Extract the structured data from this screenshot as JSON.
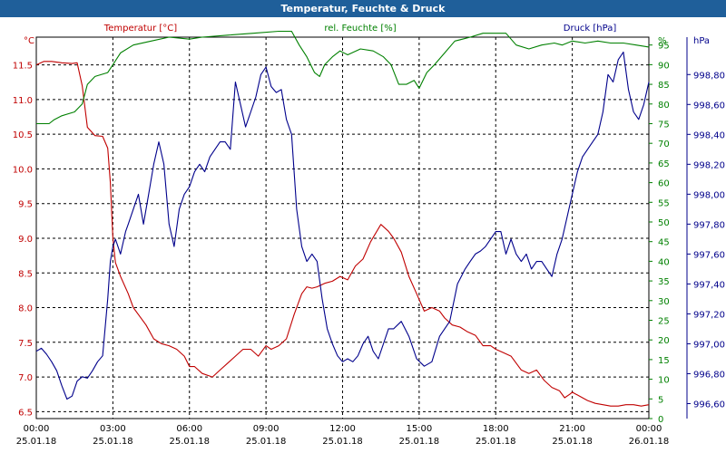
{
  "window": {
    "title": "Temperatur, Feuchte & Druck"
  },
  "axes": {
    "left": {
      "unit": "°C",
      "header": "Temperatur [°C]",
      "color": "#c00000",
      "range": [
        6.4,
        11.9
      ],
      "ticks": [
        "6.5",
        "7.0",
        "7.5",
        "8.0",
        "8.5",
        "9.0",
        "9.5",
        "10.0",
        "10.5",
        "11.0",
        "11.5"
      ]
    },
    "mid": {
      "unit": "%",
      "header": "rel. Feuchte [%]",
      "color": "#008000",
      "range": [
        0,
        97
      ],
      "ticks": [
        "0",
        "5",
        "10",
        "15",
        "20",
        "25",
        "30",
        "35",
        "40",
        "45",
        "50",
        "55",
        "60",
        "65",
        "70",
        "75",
        "80",
        "85",
        "90",
        "95"
      ]
    },
    "right": {
      "unit": "hPa",
      "header": "Druck [hPa]",
      "color": "#00008b",
      "range": [
        996.5,
        999.05
      ],
      "ticks": [
        "996,60",
        "996,80",
        "997,00",
        "997,20",
        "997,40",
        "997,60",
        "997,80",
        "998,00",
        "998,20",
        "998,40",
        "998,60",
        "998,80"
      ]
    }
  },
  "x_ticks": [
    {
      "time": "00:00",
      "date": "25.01.18"
    },
    {
      "time": "03:00",
      "date": "25.01.18"
    },
    {
      "time": "06:00",
      "date": "25.01.18"
    },
    {
      "time": "09:00",
      "date": "25.01.18"
    },
    {
      "time": "12:00",
      "date": "25.01.18"
    },
    {
      "time": "15:00",
      "date": "25.01.18"
    },
    {
      "time": "18:00",
      "date": "25.01.18"
    },
    {
      "time": "21:00",
      "date": "25.01.18"
    },
    {
      "time": "00:00",
      "date": "26.01.18"
    }
  ],
  "chart_data": {
    "type": "line",
    "x_range": [
      0,
      24
    ],
    "x_unit": "hours",
    "grid": true,
    "series": [
      {
        "name": "Temperatur [°C]",
        "axis": "left",
        "color": "#c00000",
        "x": [
          0,
          0.3,
          0.6,
          1.0,
          1.4,
          1.6,
          1.8,
          2.0,
          2.3,
          2.6,
          2.8,
          2.9,
          3.0,
          3.1,
          3.3,
          3.6,
          3.8,
          4.0,
          4.3,
          4.6,
          4.9,
          5.2,
          5.5,
          5.8,
          6.0,
          6.2,
          6.5,
          6.9,
          7.2,
          7.5,
          7.8,
          8.1,
          8.4,
          8.7,
          9.0,
          9.2,
          9.5,
          9.8,
          10.1,
          10.4,
          10.6,
          10.8,
          11.0,
          11.3,
          11.6,
          11.9,
          12.2,
          12.5,
          12.8,
          13.1,
          13.5,
          13.8,
          14.0,
          14.3,
          14.6,
          14.9,
          15.2,
          15.5,
          15.8,
          16.0,
          16.3,
          16.6,
          16.9,
          17.2,
          17.5,
          17.8,
          18.0,
          18.3,
          18.6,
          19.0,
          19.3,
          19.6,
          19.9,
          20.2,
          20.5,
          20.7,
          20.9,
          21.0,
          21.3,
          21.6,
          21.9,
          22.2,
          22.5,
          22.8,
          23.1,
          23.4,
          23.7,
          24.0
        ],
        "values": [
          11.5,
          11.55,
          11.55,
          11.53,
          11.52,
          11.53,
          11.2,
          10.6,
          10.48,
          10.47,
          10.3,
          9.8,
          9.0,
          8.65,
          8.45,
          8.2,
          8.0,
          7.9,
          7.75,
          7.55,
          7.48,
          7.45,
          7.4,
          7.3,
          7.15,
          7.15,
          7.05,
          7.0,
          7.1,
          7.2,
          7.3,
          7.4,
          7.4,
          7.3,
          7.45,
          7.4,
          7.45,
          7.55,
          7.9,
          8.2,
          8.3,
          8.28,
          8.3,
          8.35,
          8.38,
          8.45,
          8.4,
          8.6,
          8.7,
          8.95,
          9.2,
          9.1,
          9.0,
          8.8,
          8.45,
          8.2,
          7.95,
          8.0,
          7.95,
          7.85,
          7.75,
          7.72,
          7.65,
          7.6,
          7.45,
          7.45,
          7.4,
          7.35,
          7.3,
          7.1,
          7.05,
          7.1,
          6.95,
          6.85,
          6.8,
          6.7,
          6.75,
          6.78,
          6.72,
          6.66,
          6.62,
          6.6,
          6.58,
          6.58,
          6.6,
          6.6,
          6.58,
          6.6
        ]
      },
      {
        "name": "rel. Feuchte [%]",
        "axis": "mid",
        "color": "#008000",
        "x": [
          0,
          0.5,
          0.7,
          1.0,
          1.5,
          1.8,
          2.0,
          2.3,
          2.8,
          3.0,
          3.3,
          3.8,
          4.5,
          5.2,
          6.0,
          6.5,
          7.5,
          8.5,
          9.5,
          10.0,
          10.3,
          10.6,
          10.9,
          11.1,
          11.3,
          11.6,
          11.9,
          12.2,
          12.7,
          13.2,
          13.6,
          13.9,
          14.2,
          14.5,
          14.8,
          15.0,
          15.3,
          15.6,
          16.0,
          16.4,
          16.7,
          17.0,
          17.5,
          18.0,
          18.4,
          18.8,
          19.3,
          19.8,
          20.3,
          20.6,
          21.0,
          21.5,
          22.0,
          22.5,
          23.0,
          23.5,
          24.0
        ],
        "values": [
          75,
          75,
          76,
          77,
          78,
          80,
          85,
          87,
          88,
          90,
          93,
          95,
          96,
          97,
          96.5,
          97,
          97.5,
          98,
          98.5,
          98.5,
          95,
          92,
          88,
          87,
          90,
          92,
          93.5,
          92.5,
          94,
          93.5,
          92,
          90,
          85,
          85,
          86,
          84,
          88,
          90,
          93,
          96,
          96.5,
          97,
          98,
          98,
          98,
          95,
          94,
          95,
          95.5,
          95,
          96,
          95.5,
          96,
          95.5,
          95.5,
          95,
          94.5
        ]
      },
      {
        "name": "Druck [hPa]",
        "axis": "right",
        "color": "#00008b",
        "x": [
          0,
          0.2,
          0.4,
          0.6,
          0.8,
          1.0,
          1.2,
          1.4,
          1.6,
          1.8,
          2.0,
          2.2,
          2.4,
          2.6,
          2.8,
          2.9,
          3.0,
          3.1,
          3.3,
          3.5,
          3.6,
          3.8,
          4.0,
          4.2,
          4.4,
          4.6,
          4.8,
          5.0,
          5.2,
          5.4,
          5.6,
          5.8,
          6.0,
          6.2,
          6.4,
          6.6,
          6.8,
          7.0,
          7.2,
          7.4,
          7.6,
          7.8,
          8.0,
          8.2,
          8.4,
          8.6,
          8.8,
          9.0,
          9.2,
          9.4,
          9.6,
          9.8,
          10.0,
          10.2,
          10.4,
          10.6,
          10.8,
          11.0,
          11.2,
          11.4,
          11.6,
          11.8,
          12.0,
          12.2,
          12.4,
          12.6,
          12.8,
          13.0,
          13.2,
          13.4,
          13.6,
          13.8,
          14.0,
          14.3,
          14.6,
          14.9,
          15.2,
          15.5,
          15.8,
          16.0,
          16.2,
          16.5,
          16.8,
          17.0,
          17.2,
          17.4,
          17.6,
          17.8,
          18.0,
          18.2,
          18.4,
          18.6,
          18.8,
          19.0,
          19.2,
          19.4,
          19.6,
          19.8,
          20.0,
          20.2,
          20.4,
          20.6,
          20.8,
          21.0,
          21.2,
          21.4,
          21.6,
          21.8,
          22.0,
          22.2,
          22.4,
          22.6,
          22.8,
          23.0,
          23.2,
          23.4,
          23.6,
          23.8,
          24.0
        ],
        "values": [
          996.95,
          996.97,
          996.93,
          996.88,
          996.82,
          996.72,
          996.63,
          996.65,
          996.75,
          996.78,
          996.77,
          996.82,
          996.88,
          996.92,
          997.3,
          997.55,
          997.65,
          997.7,
          997.6,
          997.75,
          997.8,
          997.9,
          998.0,
          997.8,
          998.0,
          998.2,
          998.35,
          998.2,
          997.8,
          997.65,
          997.9,
          998.0,
          998.05,
          998.15,
          998.2,
          998.15,
          998.25,
          998.3,
          998.35,
          998.35,
          998.3,
          998.75,
          998.6,
          998.45,
          998.55,
          998.65,
          998.8,
          998.85,
          998.72,
          998.68,
          998.7,
          998.5,
          998.4,
          997.9,
          997.65,
          997.55,
          997.6,
          997.55,
          997.3,
          997.1,
          997.0,
          996.92,
          996.88,
          996.9,
          996.88,
          996.92,
          997.0,
          997.05,
          996.95,
          996.9,
          997.0,
          997.1,
          997.1,
          997.15,
          997.05,
          996.9,
          996.85,
          996.88,
          997.05,
          997.1,
          997.15,
          997.4,
          997.5,
          997.55,
          997.6,
          997.62,
          997.65,
          997.7,
          997.75,
          997.75,
          997.6,
          997.7,
          997.6,
          997.55,
          997.6,
          997.5,
          997.55,
          997.55,
          997.5,
          997.45,
          997.6,
          997.7,
          997.85,
          998.0,
          998.15,
          998.25,
          998.3,
          998.35,
          998.4,
          998.55,
          998.8,
          998.75,
          998.9,
          998.95,
          998.7,
          998.55,
          998.5,
          998.6,
          998.75
        ]
      }
    ]
  }
}
